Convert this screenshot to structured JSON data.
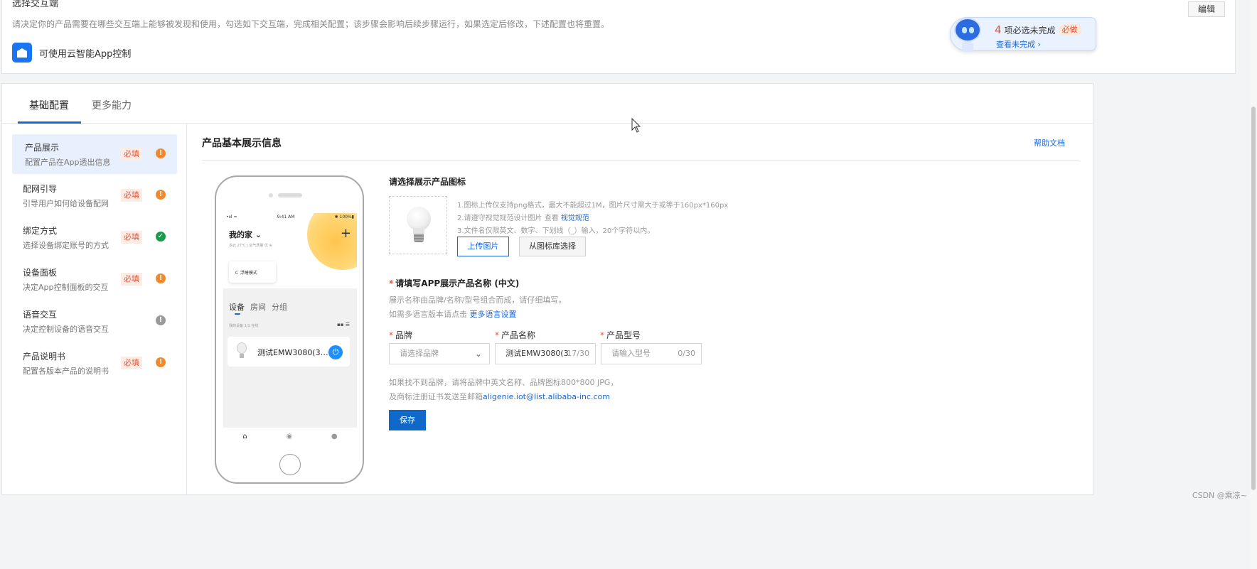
{
  "top": {
    "section_title": "选择交互端",
    "edit_label": "编辑",
    "description": "请决定你的产品需要在哪些交互端上能够被发现和使用，勾选如下交互端，完成相关配置；该步骤会影响后续步骤运行，如果选定后修改，下述配置也将重置。",
    "app_label": "可使用云智能App控制"
  },
  "tip": {
    "count": "4",
    "text": "项必选未完成",
    "badge": "必做",
    "link": "查看未完成 ›"
  },
  "tabs": [
    "基础配置",
    "更多能力"
  ],
  "sidebar": {
    "items": [
      {
        "title": "产品展示",
        "sub": "配置产品在App透出信息",
        "badge": "必填",
        "status": "!",
        "status_type": "warn"
      },
      {
        "title": "配网引导",
        "sub": "引导用户如何给设备配网",
        "badge": "必填",
        "status": "!",
        "status_type": "warn"
      },
      {
        "title": "绑定方式",
        "sub": "选择设备绑定账号的方式",
        "badge": "必填",
        "status": "✓",
        "status_type": "ok"
      },
      {
        "title": "设备面板",
        "sub": "决定App控制面板的交互",
        "badge": "必填",
        "status": "!",
        "status_type": "warn"
      },
      {
        "title": "语音交互",
        "sub": "决定控制设备的语音交互",
        "badge": "",
        "status": "!",
        "status_type": "grey"
      },
      {
        "title": "产品说明书",
        "sub": "配置各版本产品的说明书",
        "badge": "必填",
        "status": "!",
        "status_type": "warn"
      }
    ]
  },
  "content": {
    "title": "产品基本展示信息",
    "help_link": "帮助文档"
  },
  "phone": {
    "status_left": "•ııl ≈",
    "status_time": "9:41 AM",
    "status_right": "✱ 100%▮",
    "home_name": "我的家 ⌄",
    "home_info": "多云 27℃  |  空气质量 优 ⊕",
    "plus": "+",
    "scene": "Ｃ  浮睡模式",
    "tabs": [
      "设备",
      "房间",
      "分组"
    ],
    "device_meta": "我的设备  1/1 在线",
    "grid_icons": "▪▪  ☰",
    "device_name": "测试EMW3080(31...",
    "power": "⏻",
    "nav": [
      "⌂",
      "◉",
      "●"
    ]
  },
  "form": {
    "icon_label": "请选择展示产品图标",
    "hint1": "1.图标上传仅支持png格式，最大不能超过1M，图片尺寸需大于或等于160px*160px",
    "hint2_prefix": "2.请遵守视觉规范设计图片 查看 ",
    "hint2_link": "视觉规范",
    "hint3": "3.文件名仅限英文、数字、下划线（_）输入，20个字符以内。",
    "upload_label": "上传图片",
    "library_label": "从图标库选择",
    "name_label": "请填写APP展示产品名称 (中文)",
    "name_desc": "展示名称由品牌/名称/型号组合而成，请仔细填写。",
    "lang_prefix": "如需多语言版本请点击 ",
    "lang_link": "更多语言设置",
    "brand_label": "品牌",
    "brand_placeholder": "请选择品牌",
    "product_label": "产品名称",
    "product_value": "测试EMW3080(3",
    "product_counter": "17/30",
    "model_label": "产品型号",
    "model_placeholder": "请输入型号",
    "model_counter": "0/30",
    "note1": "如果找不到品牌，请将品牌中英文名称、品牌图标800*800 JPG，",
    "note2_prefix": "及商标注册证书发送至邮箱",
    "note2_email": "aligenie.iot@list.alibaba-inc.com",
    "save_label": "保存"
  },
  "watermark": "CSDN @乘凉~",
  "colors": {
    "accent": "#1a66d6",
    "required": "#e5533c",
    "warn": "#f08a2e",
    "ok": "#1a9a4b"
  }
}
